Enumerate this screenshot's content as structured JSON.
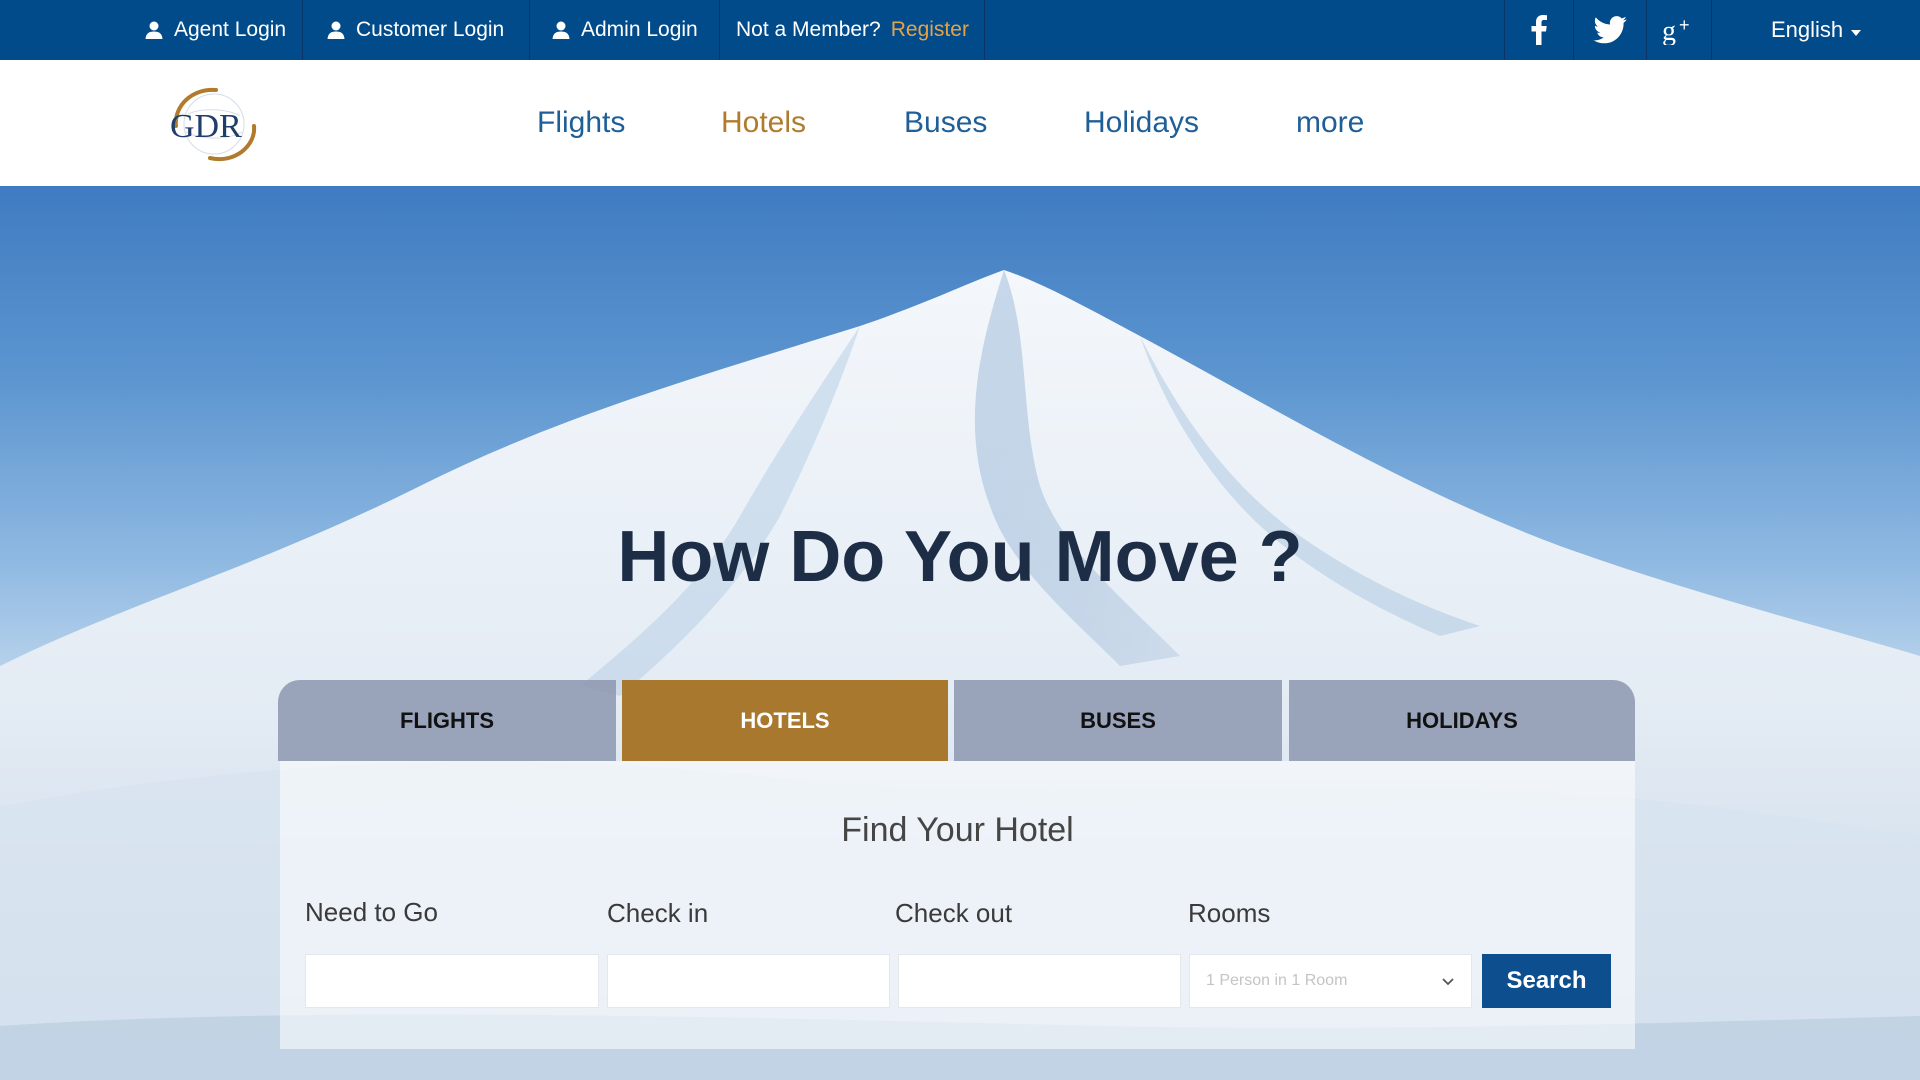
{
  "topbar": {
    "agent_login": "Agent Login",
    "customer_login": "Customer Login",
    "admin_login": "Admin Login",
    "not_member": "Not a Member?",
    "register": "Register",
    "language": "English",
    "social_icons": [
      "facebook-icon",
      "twitter-icon",
      "google-plus-icon"
    ]
  },
  "header": {
    "logo_text": "GDR",
    "nav": [
      "Flights",
      "Hotels",
      "Buses",
      "Holidays",
      "more"
    ],
    "active_nav": "Hotels"
  },
  "hero": {
    "title": "How Do You Move ?"
  },
  "search": {
    "tabs": [
      "FLIGHTS",
      "HOTELS",
      "BUSES",
      "HOLIDAYS"
    ],
    "active_tab": "HOTELS",
    "panel_title": "Find Your Hotel",
    "labels": {
      "destination": "Need to Go",
      "check_in": "Check in",
      "check_out": "Check out",
      "rooms": "Rooms"
    },
    "rooms_value": "1 Person in 1 Room",
    "search_button": "Search"
  },
  "colors": {
    "topbar": "#014b8a",
    "accent_gold": "#a8782e",
    "register": "#e7a247",
    "nav_blue": "#1f5f98",
    "search_button": "#0d4f8e"
  }
}
